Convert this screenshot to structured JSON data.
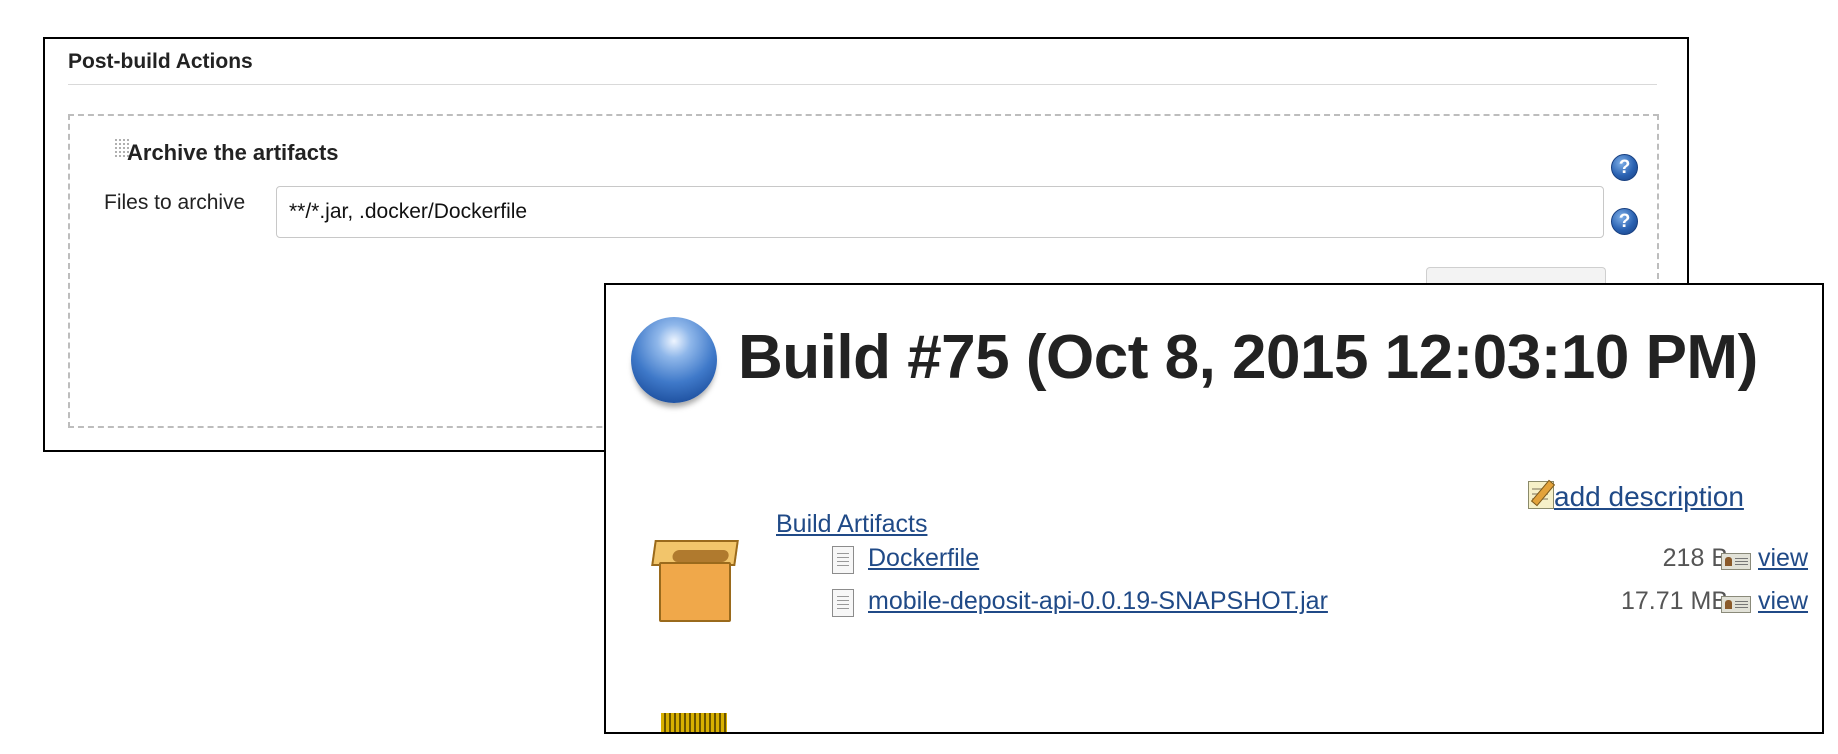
{
  "post_build": {
    "title": "Post-build Actions",
    "section_title": "Archive the artifacts",
    "files_label": "Files to archive",
    "files_value": "**/*.jar, .docker/Dockerfile",
    "help_symbol": "?"
  },
  "build": {
    "title": "Build #75 (Oct 8, 2015 12:03:10 PM)",
    "status_icon": "blue-ball-icon",
    "add_description": "add description",
    "artifacts_header": "Build Artifacts",
    "artifacts": [
      {
        "name": "Dockerfile",
        "size": "218 B",
        "view": "view"
      },
      {
        "name": "mobile-deposit-api-0.0.19-SNAPSHOT.jar",
        "size": "17.71 MB",
        "view": "view"
      }
    ]
  },
  "colors": {
    "link": "#204a87",
    "status_ball": "#3f79c9",
    "help_icon": "#2a62b2"
  }
}
